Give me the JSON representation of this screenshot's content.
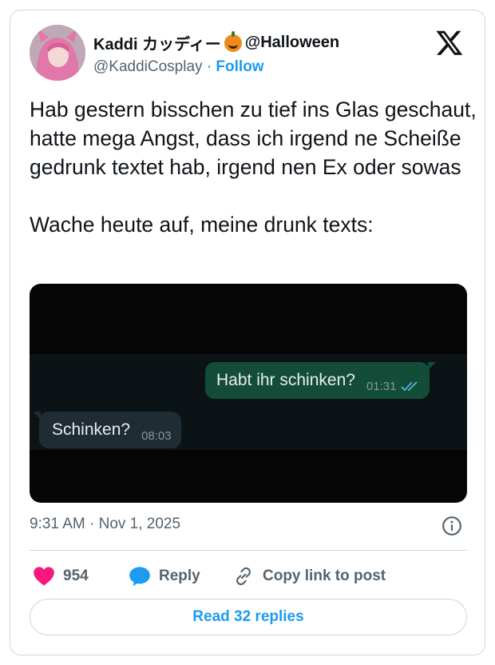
{
  "author": {
    "display_name": "Kaddi カッディー",
    "name_suffix": "@Halloween",
    "handle": "@KaddiCosplay",
    "separator": "·",
    "follow_label": "Follow"
  },
  "tweet": {
    "text": "Hab gestern bisschen zu tief ins Glas geschaut, hatte mega Angst, dass ich irgend ne Scheiße gedrunk textet hab, irgend nen Ex oder sowas\n\nWache heute auf, meine drunk texts:",
    "timestamp": "9:31 AM · Nov 1, 2025"
  },
  "chat": {
    "outgoing": {
      "text": "Habt ihr schinken?",
      "time": "01:31",
      "status_icon": "double-check-icon"
    },
    "incoming": {
      "text": "Schinken?",
      "time": "08:03"
    }
  },
  "actions": {
    "like_count": "954",
    "reply_label": "Reply",
    "copy_label": "Copy link to post"
  },
  "read_replies_label": "Read 32 replies",
  "colors": {
    "accent": "#1d9bf0",
    "like": "#f91880",
    "text_secondary": "#536471",
    "bubble_outgoing": "#134d37",
    "bubble_incoming": "#1f2c33"
  }
}
